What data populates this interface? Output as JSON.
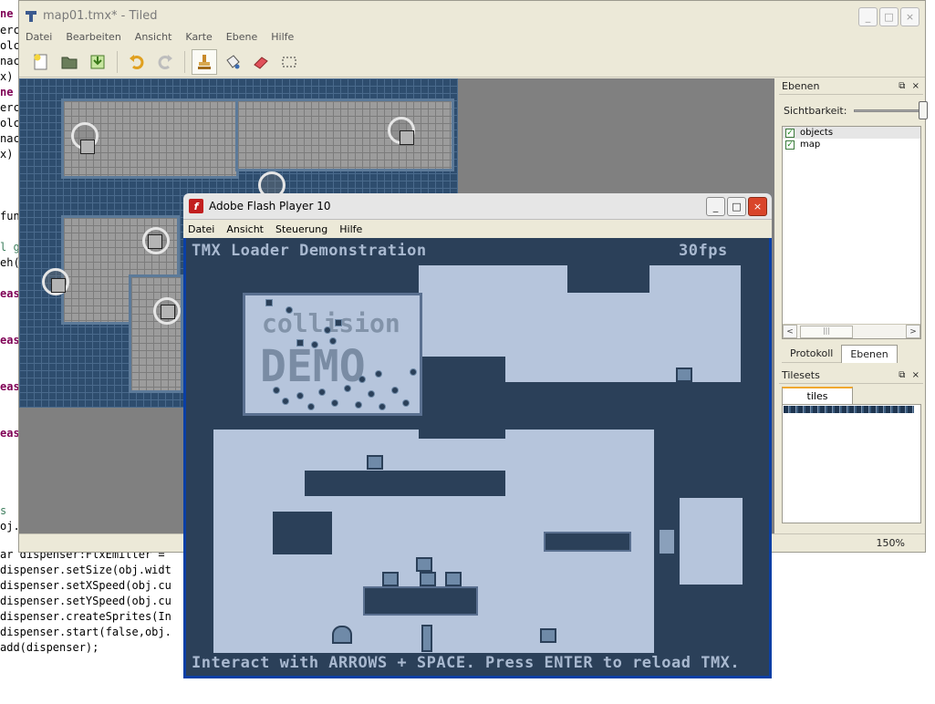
{
  "code": {
    "left_fragments": [
      {
        "text": "ne",
        "kw": true
      },
      {
        "text": "erc",
        "kw": false
      },
      {
        "text": "olc",
        "kw": false
      },
      {
        "text": "nac",
        "kw": false
      },
      {
        "text": "x)",
        "kw": false
      },
      {
        "text": "ne",
        "kw": true
      },
      {
        "text": "erc",
        "kw": false
      },
      {
        "text": "olc",
        "kw": false
      },
      {
        "text": "nac",
        "kw": false
      },
      {
        "text": "x)",
        "kw": false
      },
      {
        "text": "fun",
        "kw": false
      },
      {
        "text": "l g",
        "kw": false
      },
      {
        "text": "eh(",
        "kw": false
      },
      {
        "text": "eas",
        "kw": true
      },
      {
        "text": "eas",
        "kw": true
      },
      {
        "text": "eas",
        "kw": true
      },
      {
        "text": "eas",
        "kw": true
      },
      {
        "text": "s",
        "kw": false
      },
      {
        "text": "oj.",
        "kw": false
      }
    ],
    "bottom_lines": [
      "ar dispenser:FlxEmitter =",
      "dispenser.setSize(obj.widt",
      "dispenser.setXSpeed(obj.cu",
      "dispenser.setYSpeed(obj.cu",
      "dispenser.createSprites(In",
      "dispenser.start(false,obj.",
      "add(dispenser);"
    ]
  },
  "tiled": {
    "title": "map01.tmx* - Tiled",
    "window_buttons": [
      "_",
      "□",
      "×"
    ],
    "menu": [
      "Datei",
      "Bearbeiten",
      "Ansicht",
      "Karte",
      "Ebene",
      "Hilfe"
    ],
    "layers_panel": {
      "title": "Ebenen",
      "controls": "⧉ ×",
      "visibility_label": "Sichtbarkeit:",
      "visibility": 1.0,
      "layers": [
        {
          "name": "objects",
          "checked": true,
          "selected": true
        },
        {
          "name": "map",
          "checked": true,
          "selected": false
        }
      ],
      "scroll_left": "<",
      "scroll_right": ">",
      "scroll_thumb": "|||"
    },
    "bottom_tabs": [
      {
        "label": "Protokoll",
        "active": false
      },
      {
        "label": "Ebenen",
        "active": true
      }
    ],
    "tilesets_panel": {
      "title": "Tilesets",
      "controls": "⧉ ×",
      "tab": "tiles"
    },
    "zoom": "150%"
  },
  "flash": {
    "title": "Adobe Flash Player 10",
    "logo": "f",
    "window_buttons": [
      "_",
      "□",
      "×"
    ],
    "menu": [
      "Datei",
      "Ansicht",
      "Steuerung",
      "Hilfe"
    ],
    "stage": {
      "heading": "TMX Loader Demonstration",
      "fps": "30fps",
      "demo_line1": "collision",
      "demo_line2": "DEMO",
      "footer": "Interact with ARROWS + SPACE. Press ENTER to reload TMX."
    }
  }
}
